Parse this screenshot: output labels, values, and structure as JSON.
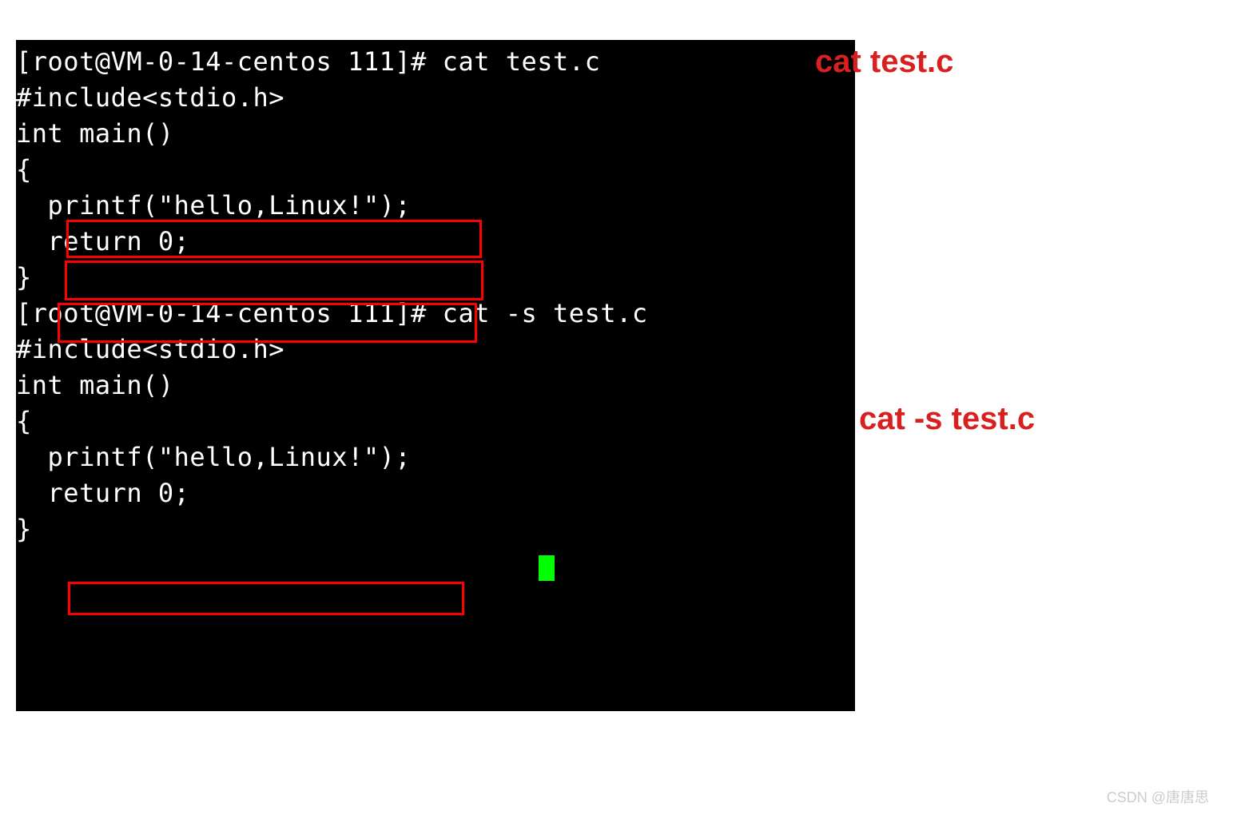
{
  "terminal": {
    "prompt1": "[root@VM-0-14-centos 111]# cat test.c",
    "code1_line1": "#include<stdio.h>",
    "code1_line2": "int main()",
    "code1_line3": "{",
    "code1_blank1": "",
    "code1_blank2": "",
    "code1_blank3": "",
    "code1_line4": "  printf(\"hello,Linux!\");",
    "code1_line5": "  return 0;",
    "code1_line6": "}",
    "prompt2": "[root@VM-0-14-centos 111]# cat -s test.c",
    "code2_line1": "#include<stdio.h>",
    "code2_line2": "int main()",
    "code2_line3": "{",
    "code2_blank1": "",
    "code2_line4": "  printf(\"hello,Linux!\");",
    "code2_line5": "  return 0;",
    "code2_line6": "}"
  },
  "annotations": {
    "label1": "cat test.c",
    "label2": "cat -s test.c"
  },
  "watermark": "CSDN @唐唐思"
}
